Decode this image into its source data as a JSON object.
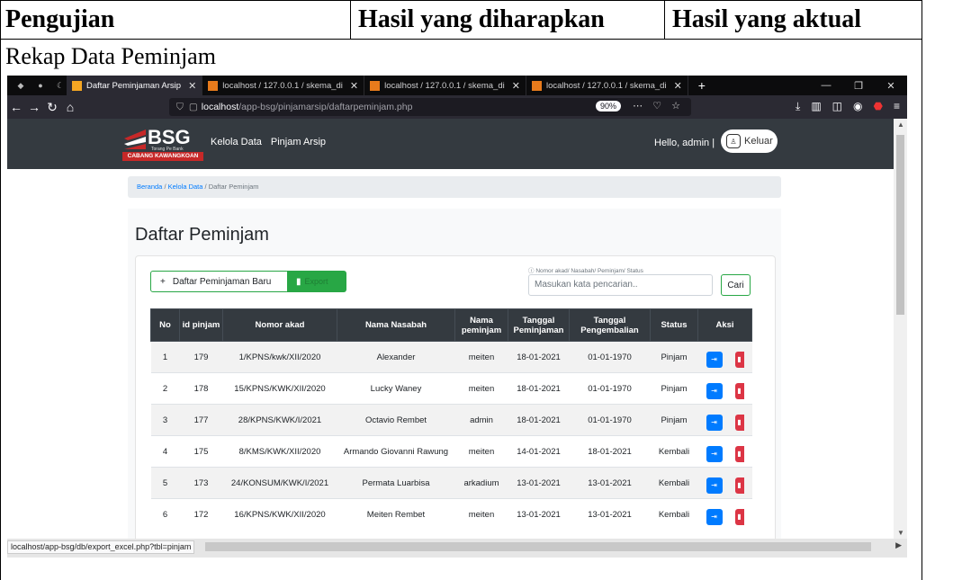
{
  "document": {
    "headers": [
      "Pengujian",
      "Hasil yang diharapkan",
      "Hasil yang aktual"
    ],
    "subtitle": "Rekap Data Peminjam"
  },
  "browser": {
    "tabs": [
      {
        "label": "Daftar Peminjaman Arsip",
        "active": true
      },
      {
        "label": "localhost / 127.0.0.1 / skema_di",
        "active": false
      },
      {
        "label": "localhost / 127.0.0.1 / skema_di",
        "active": false
      },
      {
        "label": "localhost / 127.0.0.1 / skema_di",
        "active": false
      }
    ],
    "url_host": "localhost",
    "url_path": "/app-bsg/pinjamarsip/daftarpeminjam.php",
    "zoom": "90%",
    "status_url": "localhost/app-bsg/db/export_excel.php?tbl=pinjam"
  },
  "site": {
    "logo": {
      "name": "BSG",
      "tagline": "Torang Pe Bank",
      "branch": "CABANG KAWANGKOAN"
    },
    "menu": [
      "Kelola Data",
      "Pinjam Arsip"
    ],
    "greeting": "Hello, admin |",
    "logout_label": "Keluar",
    "breadcrumb": {
      "home": "Beranda",
      "sep1": "/",
      "section": "Kelola Data",
      "sep2": "/",
      "current": "Daftar Peminjam"
    },
    "page_title": "Daftar Peminjam",
    "new_button": "Daftar Peminjaman Baru",
    "export_button": "Export",
    "search_hint": "Nomor akad/ Nasabah/ Peminjam/ Status",
    "search_placeholder": "Masukan kata pencarian..",
    "search_button": "Cari",
    "table": {
      "columns": [
        "No",
        "id pinjam",
        "Nomor akad",
        "Nama Nasabah",
        "Nama peminjam",
        "Tanggal Peminjaman",
        "Tanggal Pengembalian",
        "Status",
        "Aksi"
      ],
      "rows": [
        [
          "1",
          "179",
          "1/KPNS/kwk/XII/2020",
          "Alexander",
          "meiten",
          "18-01-2021",
          "01-01-1970",
          "Pinjam"
        ],
        [
          "2",
          "178",
          "15/KPNS/KWK/XII/2020",
          "Lucky Waney",
          "meiten",
          "18-01-2021",
          "01-01-1970",
          "Pinjam"
        ],
        [
          "3",
          "177",
          "28/KPNS/KWK/I/2021",
          "Octavio Rembet",
          "admin",
          "18-01-2021",
          "01-01-1970",
          "Pinjam"
        ],
        [
          "4",
          "175",
          "8/KMS/KWK/XII/2020",
          "Armando Giovanni Rawung",
          "meiten",
          "14-01-2021",
          "18-01-2021",
          "Kembali"
        ],
        [
          "5",
          "173",
          "24/KONSUM/KWK/I/2021",
          "Permata Luarbisa",
          "arkadium",
          "13-01-2021",
          "13-01-2021",
          "Kembali"
        ],
        [
          "6",
          "172",
          "16/KPNS/KWK/XII/2020",
          "Meiten Rembet",
          "meiten",
          "13-01-2021",
          "13-01-2021",
          "Kembali"
        ]
      ]
    }
  }
}
